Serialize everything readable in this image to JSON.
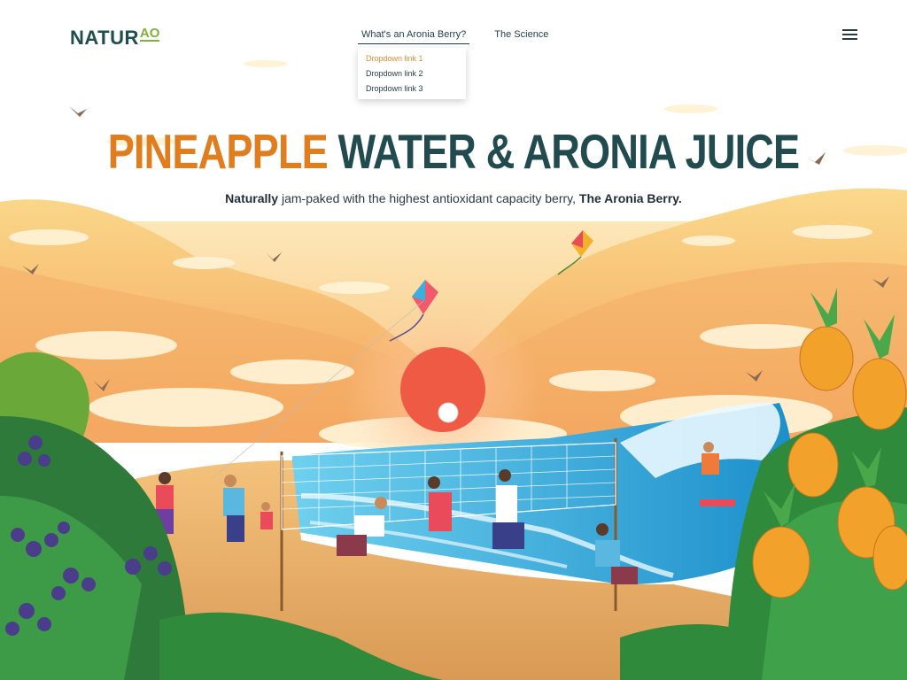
{
  "header": {
    "logo_main": "NATUR",
    "logo_accent": "AO",
    "nav": [
      {
        "label": "What's an Aronia Berry?"
      },
      {
        "label": "The Science"
      }
    ],
    "dropdown": [
      {
        "label": "Dropdown link 1"
      },
      {
        "label": "Dropdown link 2"
      },
      {
        "label": "Dropdown link 3"
      }
    ]
  },
  "hero": {
    "title_part1": "PINEAPPLE",
    "title_part2": "WATER & ARONIA JUICE",
    "subtitle_bold1": "Naturally",
    "subtitle_middle": " jam-paked with the highest antioxidant capacity berry, ",
    "subtitle_bold2": "The Aronia Berry."
  },
  "colors": {
    "title_orange": "#e07d1f",
    "title_dark": "#214b4e",
    "logo_green": "#7fb13c",
    "sun": "#ef5a45",
    "sea": "#27a4d6"
  }
}
